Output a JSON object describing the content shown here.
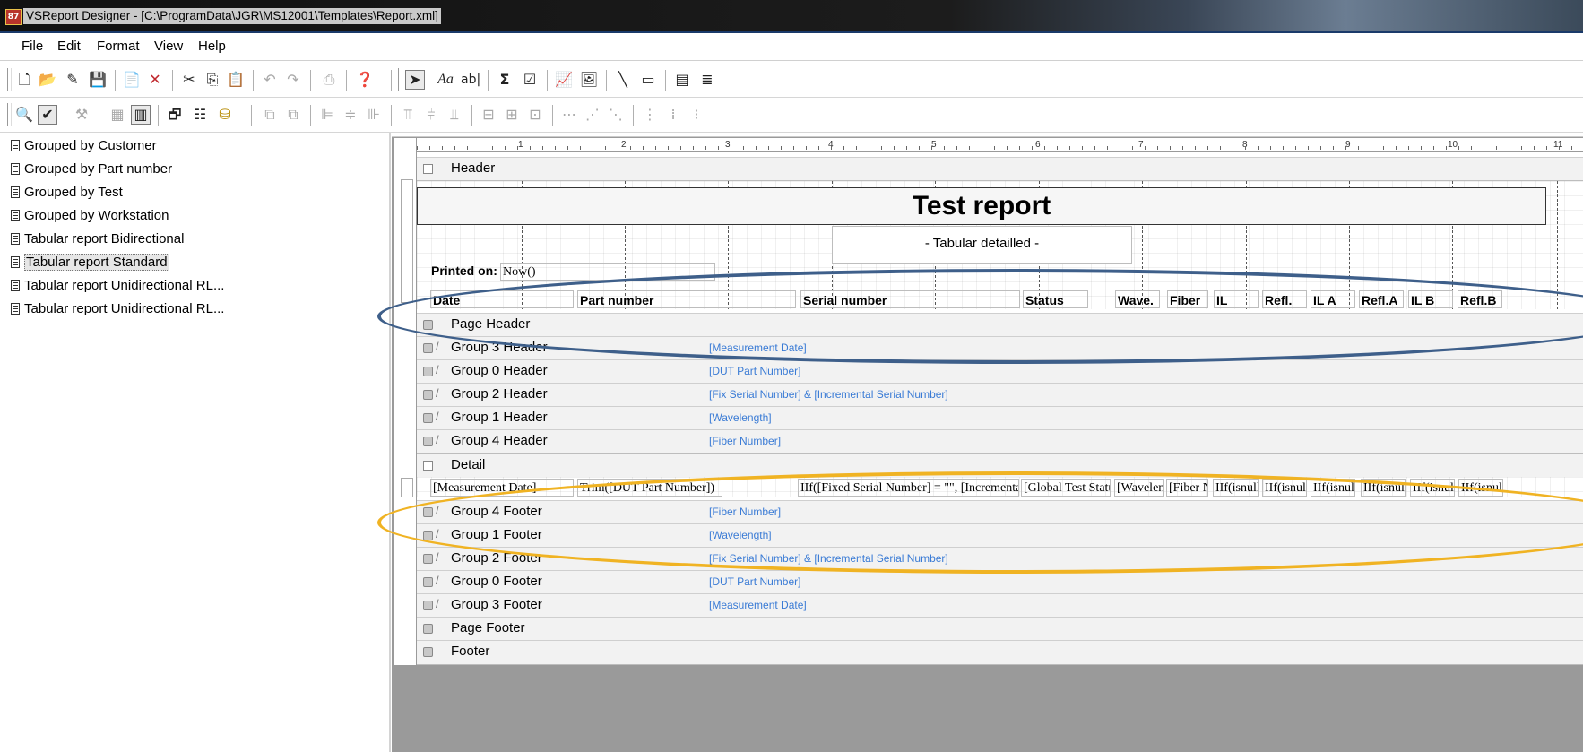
{
  "window": {
    "title": "VSReport Designer - [C:\\ProgramData\\JGR\\MS12001\\Templates\\Report.xml]",
    "app_icon_text": "87"
  },
  "menu": {
    "file": "File",
    "edit": "Edit",
    "format": "Format",
    "view": "View",
    "help": "Help"
  },
  "toolbar1": [
    "new-icon",
    "open-icon",
    "design-icon",
    "save-icon",
    "insert-report-icon",
    "delete-icon",
    "cut-icon",
    "copy-icon",
    "paste-icon",
    "undo-icon",
    "redo-icon",
    "print-icon",
    "help-icon",
    "pointer-icon",
    "label-icon",
    "field-icon",
    "sum-icon",
    "checkbox-icon",
    "chart-icon",
    "image-icon",
    "line-icon",
    "rectangle-icon",
    "subreport-icon",
    "pagebreak-icon"
  ],
  "toolbar2": [
    "preview-icon",
    "design-mode-icon",
    "wizard-icon",
    "grid-icon",
    "snap-icon",
    "properties-icon",
    "groups-icon",
    "datasource-icon",
    "bring-front-icon",
    "send-back-icon",
    "align-left-icon",
    "align-center-icon",
    "align-right-icon",
    "align-top-icon",
    "align-middle-icon",
    "align-bottom-icon",
    "same-width-icon",
    "same-height-icon",
    "same-size-icon",
    "hspace-equal-icon",
    "hspace-inc-icon",
    "hspace-dec-icon",
    "vspace-equal-icon",
    "vspace-inc-icon",
    "vspace-dec-icon"
  ],
  "reports": [
    "Grouped  by Customer",
    "Grouped  by Part number",
    "Grouped  by Test",
    "Grouped  by Workstation",
    "Tabular report Bidirectional",
    "Tabular report Standard",
    "Tabular report Unidirectional RL...",
    "Tabular report Unidirectional RL..."
  ],
  "selected_report_index": 5,
  "ruler": [
    "1",
    "2",
    "3",
    "4",
    "5",
    "6",
    "7",
    "8",
    "9",
    "10",
    "11"
  ],
  "header": {
    "band": "Header",
    "title": "Test report",
    "subtitle": "- Tabular detailled -",
    "printed_on_label": "Printed on:",
    "printed_on_value": "Now()",
    "columns": [
      "Date",
      "Part number",
      "Serial number",
      "Status",
      "Wave.",
      "Fiber",
      "IL",
      "Refl.",
      "IL A",
      "Refl.A",
      "IL B",
      "Refl.B"
    ]
  },
  "bands_upper": [
    {
      "name": "Page Header",
      "expr": ""
    },
    {
      "name": "Group 3 Header",
      "expr": "[Measurement Date]"
    },
    {
      "name": "Group 0 Header",
      "expr": "[DUT Part Number]"
    },
    {
      "name": "Group 2 Header",
      "expr": "[Fix Serial Number] & [Incremental Serial Number]"
    },
    {
      "name": "Group 1 Header",
      "expr": "[Wavelength]"
    },
    {
      "name": "Group 4 Header",
      "expr": "[Fiber Number]"
    }
  ],
  "detail": {
    "band": "Detail",
    "fields": [
      "[Measurement Date]",
      "Trim([DUT Part Number])",
      "IIf([Fixed Serial Number] = \"\", [Incrementa",
      "[Global Test Statu",
      "[Wavelen",
      "[Fiber N",
      "IIf(isnull",
      "IIf(isnull",
      "IIf(isnul",
      "IIf(isnull",
      "IIf(isnul",
      "IIf(isnull"
    ]
  },
  "bands_lower": [
    {
      "name": "Group 4 Footer",
      "expr": "[Fiber Number]"
    },
    {
      "name": "Group 1 Footer",
      "expr": "[Wavelength]"
    },
    {
      "name": "Group 2 Footer",
      "expr": "[Fix Serial Number] & [Incremental Serial Number]"
    },
    {
      "name": "Group 0 Footer",
      "expr": "[DUT Part Number]"
    },
    {
      "name": "Group 3 Footer",
      "expr": "[Measurement Date]"
    },
    {
      "name": "Page Footer",
      "expr": ""
    },
    {
      "name": "Footer",
      "expr": ""
    }
  ],
  "colors": {
    "blue_annotation": "#3e5f8a",
    "orange_annotation": "#f0b323",
    "expression_text": "#3a7bd5",
    "band_bg": "#f2f2f2"
  }
}
